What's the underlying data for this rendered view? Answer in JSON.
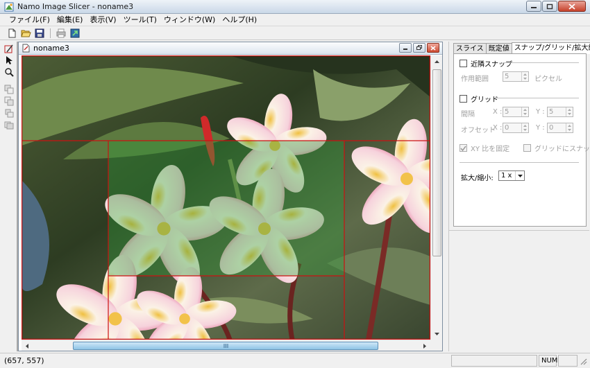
{
  "window": {
    "title": "Namo Image Slicer - noname3"
  },
  "menu": [
    "ファイル(F)",
    "編集(E)",
    "表示(V)",
    "ツール(T)",
    "ウィンドウ(W)",
    "ヘルプ(H)"
  ],
  "toolbar": {
    "icons": [
      "new-file-icon",
      "open-folder-icon",
      "save-icon",
      "print-icon",
      "export-icon"
    ]
  },
  "tools": {
    "icons": [
      "slice-tool-icon",
      "pointer-tool-icon",
      "zoom-tool-icon",
      "layer-front-icon",
      "layer-forward-icon",
      "layer-backward-icon",
      "layer-back-icon"
    ]
  },
  "document": {
    "title": "noname3"
  },
  "panel": {
    "tabs": [
      "スライス",
      "既定値",
      "スナップ/グリッド/拡大縮小"
    ],
    "active_tab": 2,
    "snap_label": "近隣スナップ",
    "range_label": "作用範囲",
    "range_value": "5",
    "range_unit": "ピクセル",
    "grid_label": "グリッド",
    "interval_label": "間隔",
    "interval_x_label": "X :",
    "interval_x": "5",
    "interval_y_label": "Y :",
    "interval_y": "5",
    "offset_label": "オフセット",
    "offset_x_label": "X :",
    "offset_x": "0",
    "offset_y_label": "Y :",
    "offset_y": "0",
    "xy_lock_label": "XY 比を固定",
    "grid_snap_label": "グリッドにスナップ",
    "zoom_label": "拡大/縮小:",
    "zoom_value": "1 x"
  },
  "status": {
    "coords": "(657, 557)",
    "num": "NUM"
  },
  "colors": {
    "slice_line": "#cc1111",
    "slice_fill": "#2f9a3a",
    "scroll_thumb": "#8fc4e6"
  }
}
